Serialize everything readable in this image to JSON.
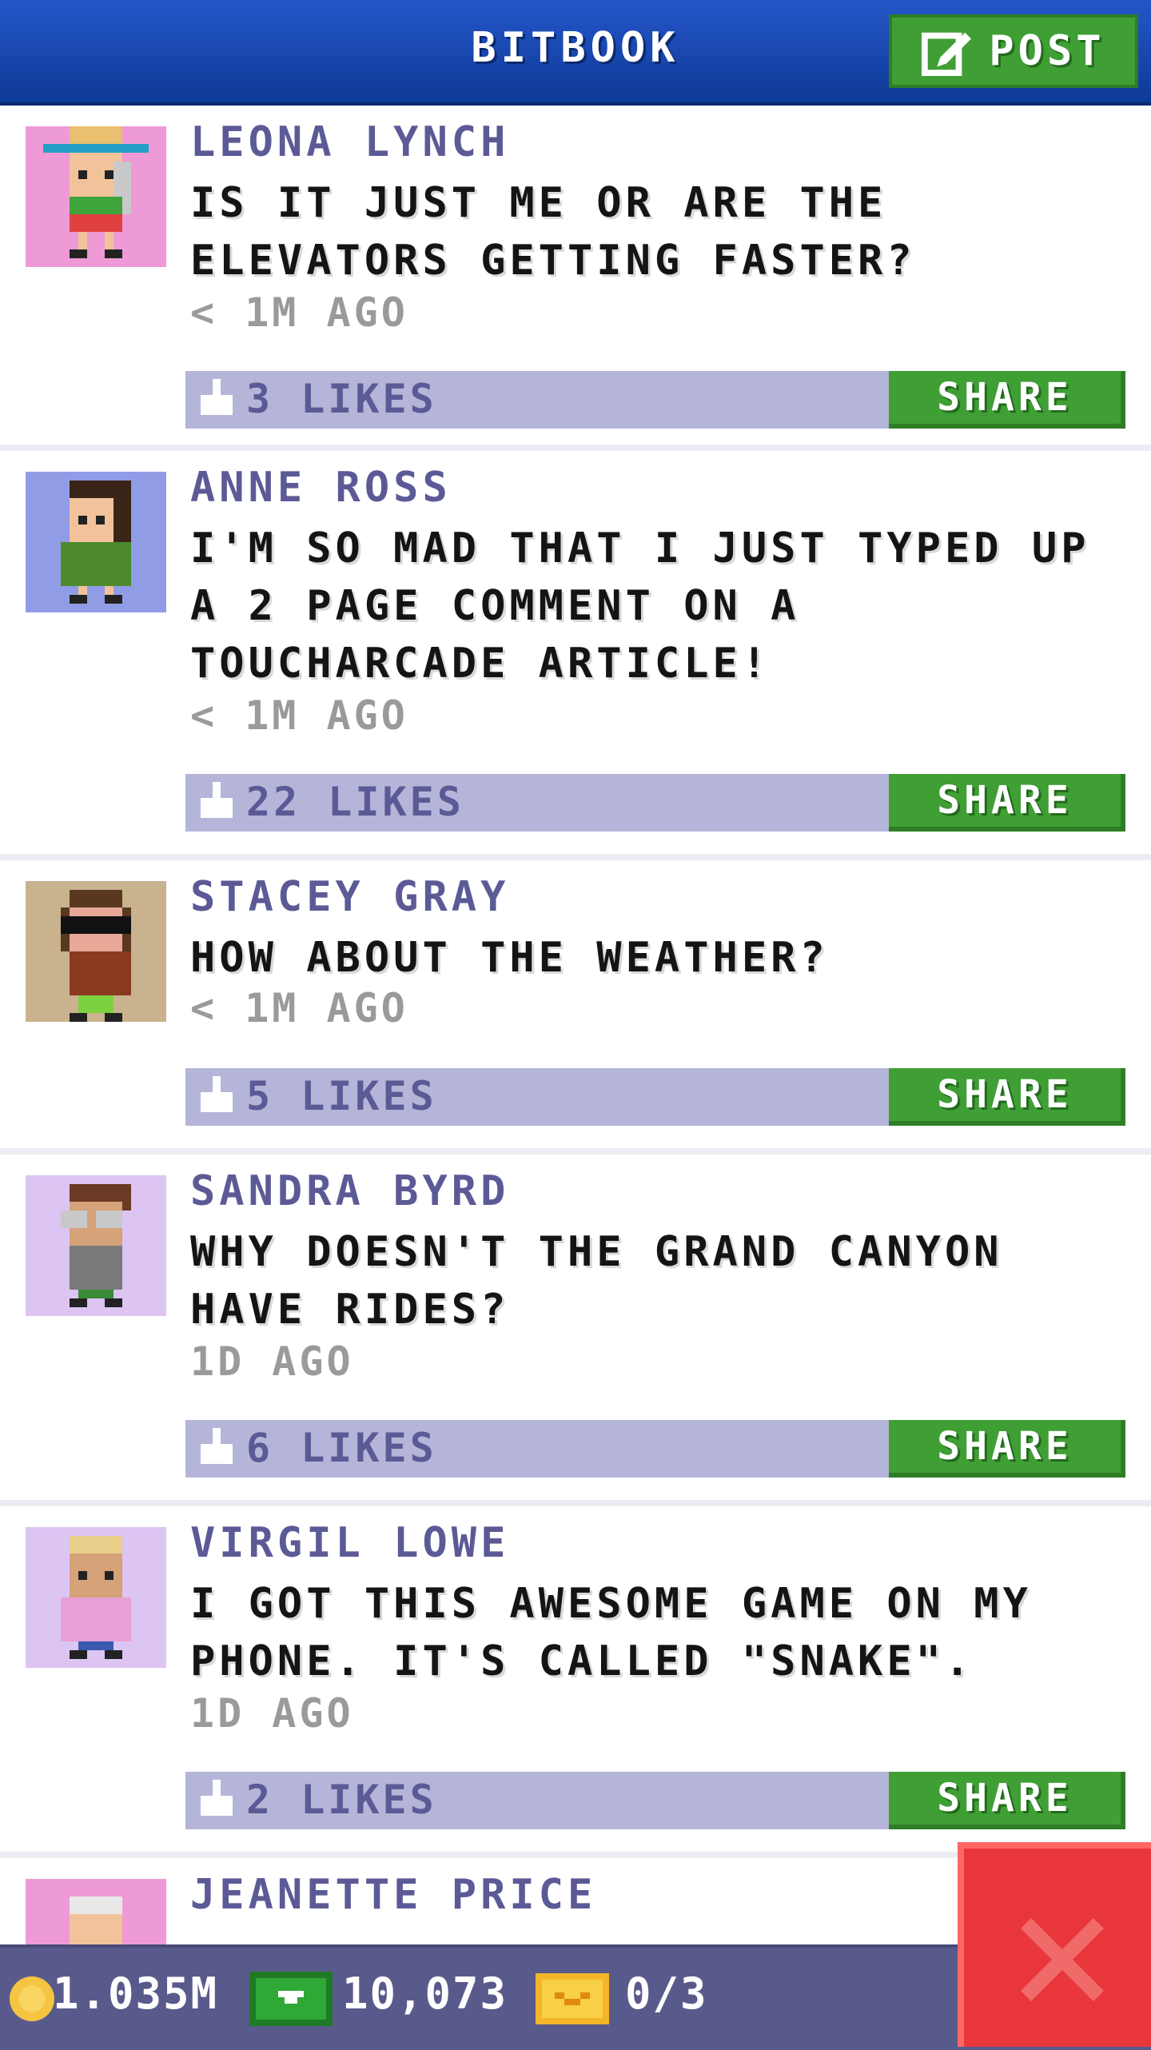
{
  "header": {
    "title": "BITBOOK",
    "post_label": "POST"
  },
  "posts": [
    {
      "name": "LEONA LYNCH",
      "message": "IS IT JUST ME OR ARE THE ELEVATORS GETTING FASTER?",
      "time": "< 1M AGO",
      "likes": "3 LIKES",
      "share_label": "SHARE",
      "avatar_bg": "#ee9ad6"
    },
    {
      "name": "ANNE ROSS",
      "message": "I'M SO MAD THAT I JUST TYPED UP A 2 PAGE COMMENT ON A TOUCHARCADE ARTICLE!",
      "time": "< 1M AGO",
      "likes": "22 LIKES",
      "share_label": "SHARE",
      "avatar_bg": "#909de6"
    },
    {
      "name": "STACEY GRAY",
      "message": "HOW ABOUT THE WEATHER?",
      "time": "< 1M AGO",
      "likes": "5 LIKES",
      "share_label": "SHARE",
      "avatar_bg": "#c9b38e"
    },
    {
      "name": "SANDRA BYRD",
      "message": "WHY DOESN'T THE GRAND CANYON HAVE RIDES?",
      "time": "1D AGO",
      "likes": "6 LIKES",
      "share_label": "SHARE",
      "avatar_bg": "#dcc4f3"
    },
    {
      "name": "VIRGIL LOWE",
      "message": "I GOT THIS AWESOME GAME ON MY PHONE. IT'S CALLED \"SNAKE\".",
      "time": "1D AGO",
      "likes": "2 LIKES",
      "share_label": "SHARE",
      "avatar_bg": "#dcc4f3"
    },
    {
      "name": "JEANETTE PRICE",
      "avatar_bg": "#ee9ad6"
    }
  ],
  "footer": {
    "coins": "1.035M",
    "bux": "10,073",
    "tickets": "0/3"
  },
  "colors": {
    "header_blue": "#1a4bb8",
    "share_green": "#3f9f35",
    "likes_bar": "#b4b5d8",
    "close_red": "#e8363a"
  }
}
